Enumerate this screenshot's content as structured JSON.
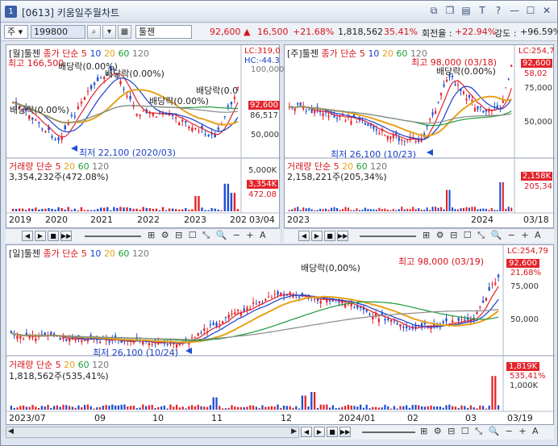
{
  "window": {
    "num": "1",
    "title": "[0613] 키움일주월차트"
  },
  "toolbar": {
    "market": "주",
    "code": "199800",
    "name": "툴젠",
    "price": "92,600",
    "change_arrow": "▲",
    "change": "16,500",
    "change_rate": "+21.68%",
    "volume": "1,818,562",
    "vol_rate": "35.41%",
    "turnover_label": "회전율 :",
    "turnover": "+22.94%",
    "strength_label": "강도 :",
    "strength": "+96.59%"
  },
  "panels": {
    "monthly": {
      "header": "[월]툴젠",
      "price_legend": "종가 단순 5",
      "ma": [
        "10",
        "20",
        "60",
        "120"
      ],
      "lc": "LC:319,0",
      "hc": "HC:-44.3",
      "annotations": {
        "high": "최고 166,500",
        "div1": "배당락(0.00%)",
        "div2": "배당락(0.00%)",
        "div3": "배당락(0.00%)",
        "div4": "배당락(0.00%)",
        "div5": "배당락(0.00%)",
        "div6": "배당락(0.0",
        "low": "최저 22,100 (2020/03)"
      },
      "yticks": [
        "100,000",
        "86,517",
        "50,000"
      ],
      "price_tag": "92,600",
      "vol_legend": "거래량 단순 5",
      "vol_ma": [
        "20",
        "60",
        "120"
      ],
      "vol_info": "3,354,232주(472.08%)",
      "vol_yticks": [
        "5,000K",
        "472.08"
      ],
      "vol_tag": "3,354K",
      "xticks": [
        "2019",
        "2020",
        "2021",
        "2022",
        "2023",
        "202"
      ],
      "date": "03/04"
    },
    "weekly": {
      "header": "[주]툴젠",
      "price_legend": "종가 단순 5",
      "ma": [
        "10",
        "20",
        "60",
        "120"
      ],
      "lc": "LC:254,7",
      "annotations": {
        "high": "최고 98,000 (03/18)",
        "div": "배당락(0.00%)",
        "low": "최저 26,100 (10/23)"
      },
      "yticks": [
        "58,02",
        "75,000",
        "50,000"
      ],
      "price_tag": "92,600",
      "vol_legend": "거래량 단순 5",
      "vol_ma": [
        "20",
        "60",
        "120"
      ],
      "vol_info": "2,158,221주(205,34%)",
      "vol_yticks": [
        "205,34"
      ],
      "vol_tag": "2,158K",
      "xticks": [
        "2023",
        "2024"
      ],
      "date": "03/18"
    },
    "daily": {
      "header": "[일]툴젠",
      "price_legend": "종가 단순 5",
      "ma": [
        "10",
        "20",
        "60",
        "120"
      ],
      "lc": "LC:254,79",
      "annotations": {
        "high": "최고 98,000 (03/19)",
        "div": "배당락(0,00%)",
        "low": "최저 26,100 (10/24)"
      },
      "yticks": [
        "21,68%",
        "75,000",
        "50,000"
      ],
      "price_tag": "92,600",
      "vol_legend": "거래량 단순 5",
      "vol_ma": [
        "20",
        "60",
        "120"
      ],
      "vol_info": "1,818,562주(535,41%)",
      "vol_yticks": [
        "535,41%",
        "1,000K"
      ],
      "vol_tag": "1,819K",
      "xticks": [
        "2023/07",
        "09",
        "10",
        "11",
        "12",
        "2024/01",
        "02",
        "03"
      ],
      "date": "03/19"
    }
  },
  "nav": {
    "buttons": [
      "◀",
      "▶",
      "■",
      "▶▶"
    ],
    "icons": "⊞ ⚙ ⊟ ☐ ⤡ 🔍 − + A"
  },
  "colors": {
    "up": "#e3242b",
    "down": "#1f4fd1",
    "ma5": "#e0232e",
    "ma10": "#1b3fc9",
    "ma20": "#e7a11a",
    "ma60": "#1e9a3a",
    "ma120": "#8a8a8a"
  }
}
